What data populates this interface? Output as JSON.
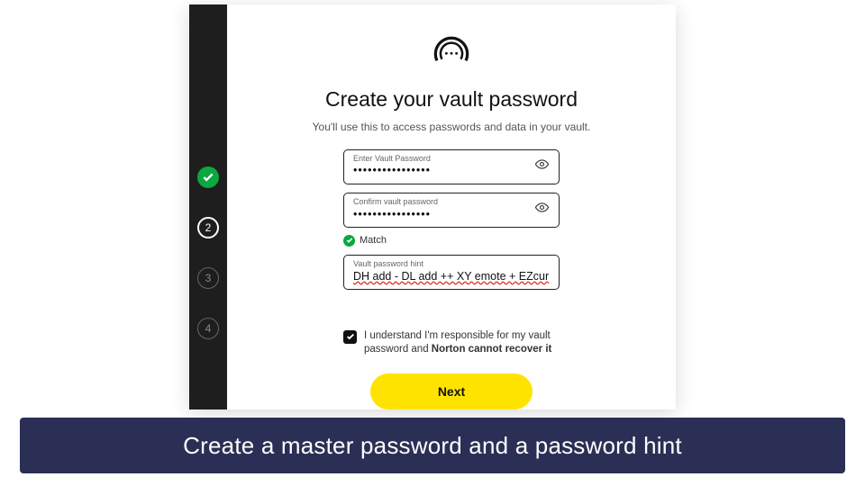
{
  "steps": {
    "step2": "2",
    "step3": "3",
    "step4": "4"
  },
  "header": {
    "title": "Create your vault password",
    "subtitle": "You'll use this to access passwords and data in your vault."
  },
  "fields": {
    "password": {
      "label": "Enter Vault Password",
      "value": "••••••••••••••••"
    },
    "confirm": {
      "label": "Confirm vault password",
      "value": "••••••••••••••••"
    },
    "hint": {
      "label": "Vault password hint",
      "value": "DH add - DL add ++ XY emote + EZcur"
    }
  },
  "match": {
    "label": "Match"
  },
  "consent": {
    "text_prefix": "I understand I'm responsible for my vault password and ",
    "text_bold": "Norton cannot recover it"
  },
  "buttons": {
    "next": "Next"
  },
  "caption": "Create a master password and a password hint",
  "colors": {
    "accent": "#ffe300",
    "success": "#0aa83f",
    "caption_bg": "#2b2f55"
  }
}
